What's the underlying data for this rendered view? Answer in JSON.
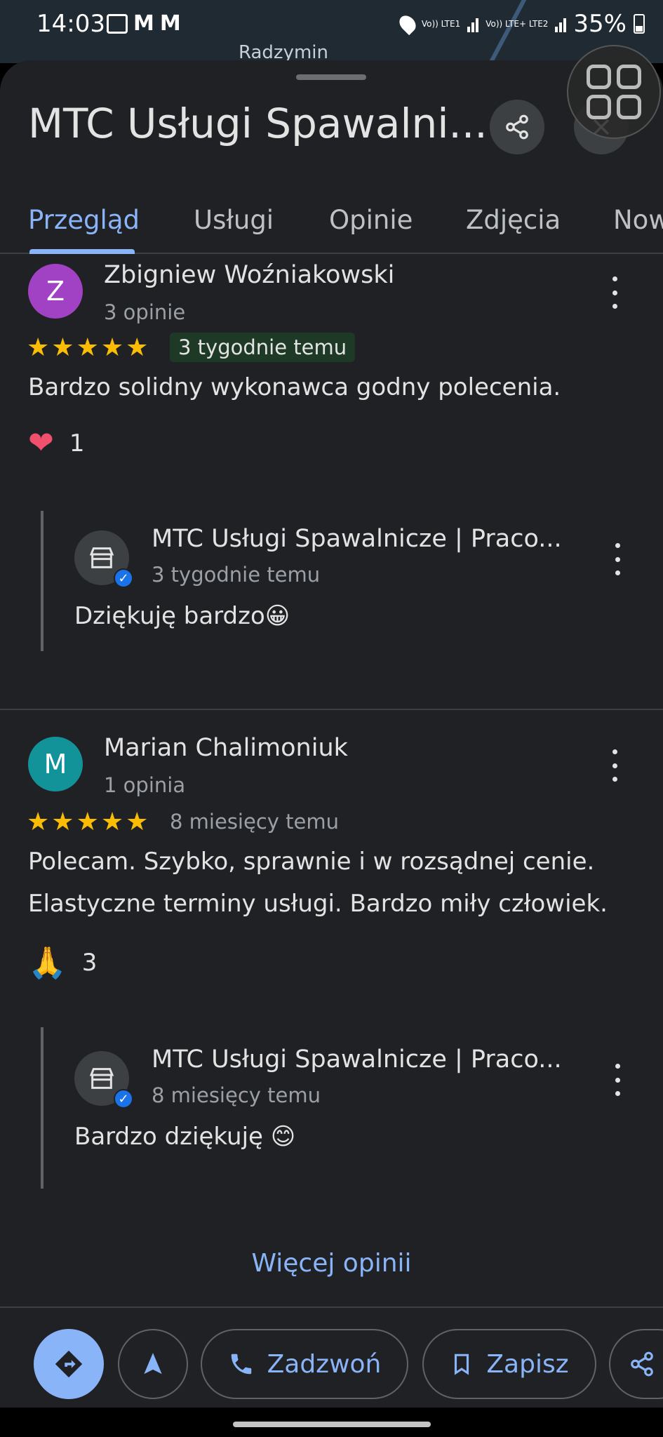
{
  "status_bar": {
    "time": "14:03",
    "battery": "35%",
    "network_1": "Vo)) LTE1",
    "network_2": "Vo)) LTE+ LTE2"
  },
  "map": {
    "label": "Radzymin"
  },
  "place": {
    "title": "MTC Usługi Spawalni..."
  },
  "tabs": [
    {
      "label": "Przegląd",
      "active": true
    },
    {
      "label": "Usługi"
    },
    {
      "label": "Opinie"
    },
    {
      "label": "Zdjęcia"
    },
    {
      "label": "Now"
    }
  ],
  "reviews": [
    {
      "avatar_letter": "Z",
      "avatar_color": "#a142c4",
      "author": "Zbigniew Woźniakowski",
      "author_meta": "3 opinie",
      "rating": 5,
      "date": "3 tygodnie temu",
      "text": "Bardzo solidny wykonawca godny polecenia.",
      "reaction_icon": "heart",
      "reaction_count": "1",
      "reply": {
        "author": "MTC Usługi Spawalnicze | Praco...",
        "date": "3 tygodnie temu",
        "text": "Dziękuję bardzo😀"
      }
    },
    {
      "avatar_letter": "M",
      "avatar_color": "#12939a",
      "author": "Marian Chalimoniuk",
      "author_meta": "1 opinia",
      "rating": 5,
      "date": "8 miesięcy temu",
      "text": "Polecam. Szybko, sprawnie i w rozsądnej cenie. Elastyczne terminy usługi. Bardzo miły człowiek.",
      "reaction_icon": "folded-hands",
      "reaction_count": "3",
      "reply": {
        "author": "MTC Usługi Spawalnicze | Praco...",
        "date": "8 miesięcy temu",
        "text": "Bardzo dziękuję 😊"
      }
    }
  ],
  "more_reviews_label": "Więcej opinii",
  "actions": {
    "call_label": "Zadzwoń",
    "save_label": "Zapisz"
  },
  "colors": {
    "accent": "#8ab4f8",
    "background": "#202124",
    "star": "#fbbc04"
  }
}
